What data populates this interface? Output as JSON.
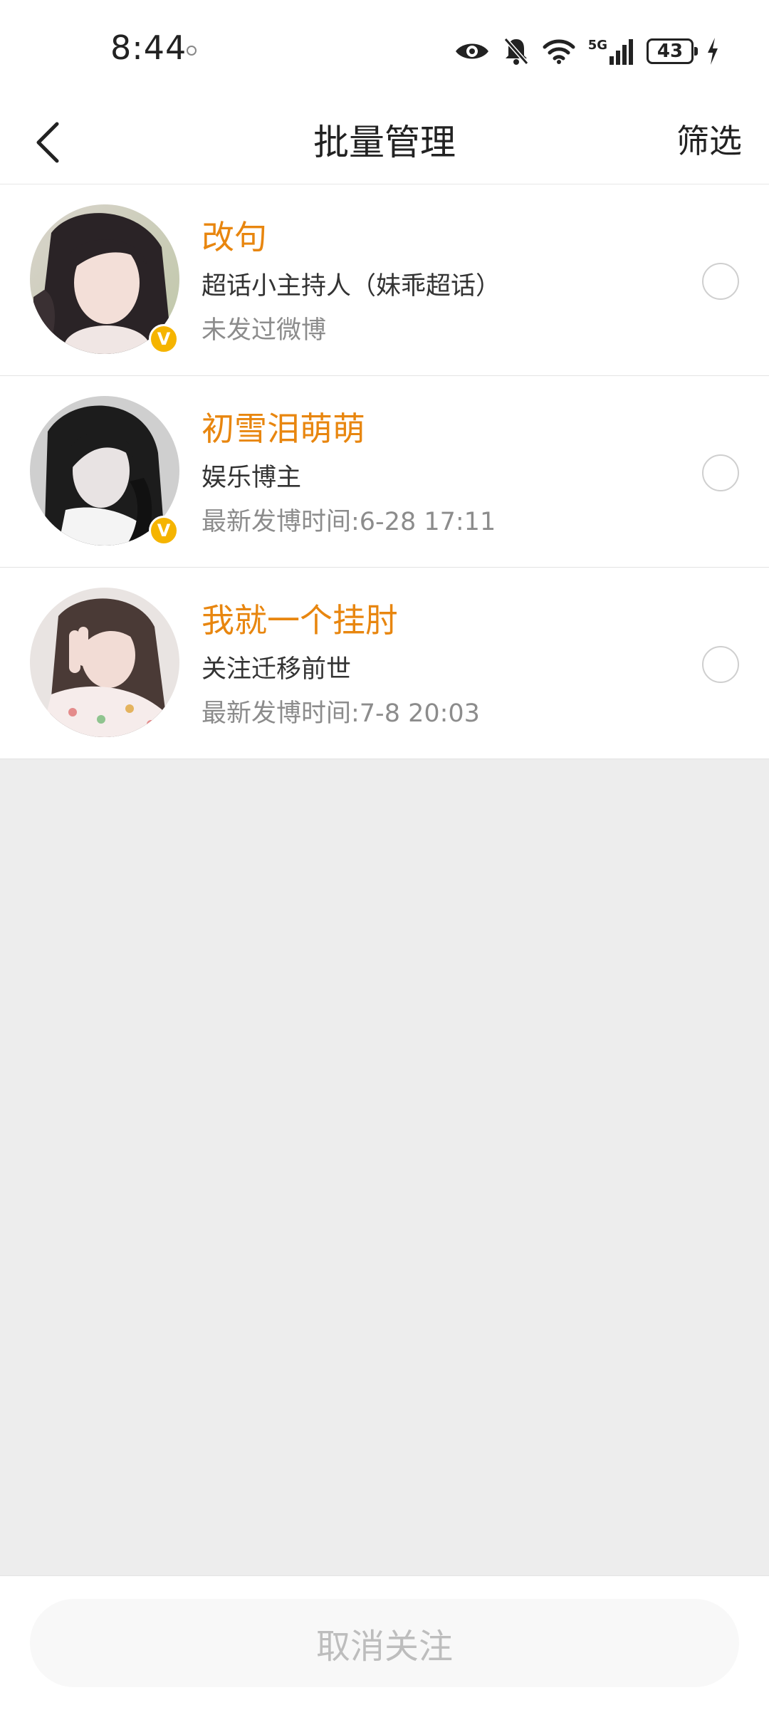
{
  "status_bar": {
    "time": "8:44",
    "battery": "43",
    "network": "5G",
    "icons": [
      "eye-icon",
      "bell-off-icon",
      "wifi-icon",
      "signal-icon",
      "battery-icon",
      "charging-icon"
    ]
  },
  "nav": {
    "title": "批量管理",
    "filter_label": "筛选",
    "back_icon": "chevron-left-icon"
  },
  "users": [
    {
      "name": "改句",
      "description": "超话小主持人（妹乖超话）",
      "last_post": "未发过微博",
      "verified": true
    },
    {
      "name": "初雪泪萌萌",
      "description": "娱乐博主",
      "last_post": "最新发博时间:6-28 17:11",
      "verified": true
    },
    {
      "name": "我就一个挂肘",
      "description": "关注迁移前世",
      "last_post": "最新发博时间:7-8 20:03",
      "verified": false
    }
  ],
  "bottom": {
    "unfollow_label": "取消关注"
  },
  "colors": {
    "name_accent": "#e8860f",
    "verified_badge": "#f5b400",
    "background": "#ededed"
  }
}
